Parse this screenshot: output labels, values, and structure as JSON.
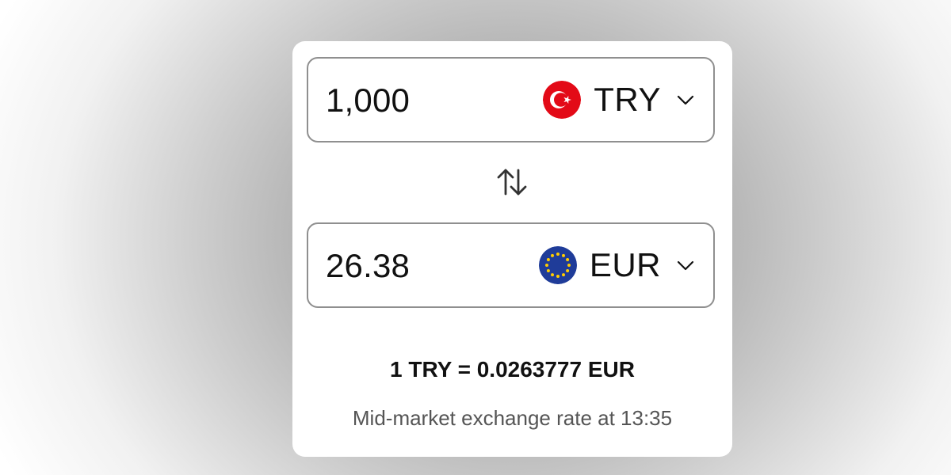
{
  "converter": {
    "from": {
      "amount": "1,000",
      "currency_code": "TRY",
      "flag_icon": "turkey-flag-icon",
      "dropdown_icon": "chevron-down-icon"
    },
    "to": {
      "amount": "26.38",
      "currency_code": "EUR",
      "flag_icon": "eu-flag-icon",
      "dropdown_icon": "chevron-down-icon"
    },
    "swap_icon": "swap-arrows-icon",
    "rate_text": "1 TRY = 0.0263777 EUR",
    "rate_note": "Mid-market exchange rate at 13:35"
  },
  "colors": {
    "text": "#111111",
    "muted_text": "#555555",
    "border": "#8f8f8f",
    "turkey_red": "#e30a17",
    "eu_blue": "#1f3c99",
    "eu_star": "#ffcc00"
  }
}
